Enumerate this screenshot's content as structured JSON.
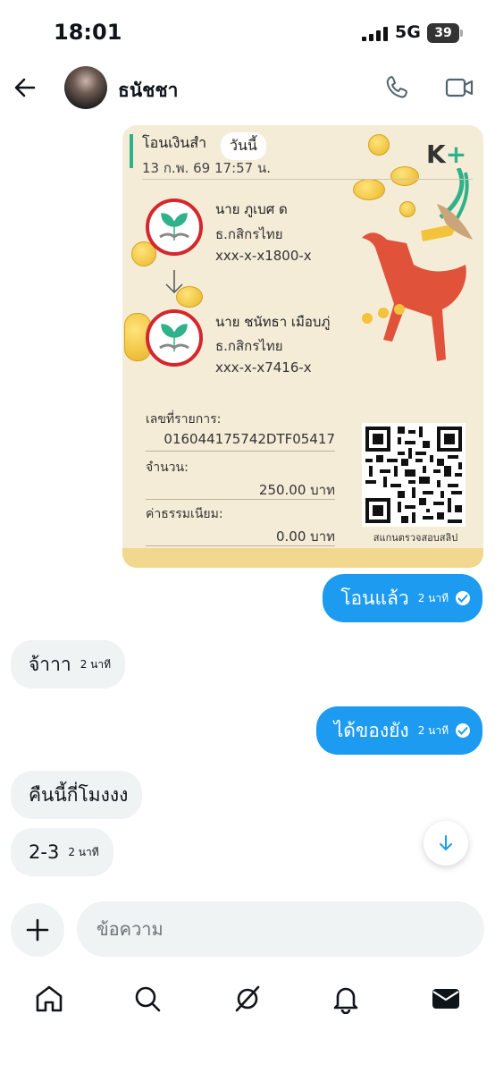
{
  "status_bar": {
    "time": "18:01",
    "network": "5G",
    "battery": "39"
  },
  "header": {
    "contact_name": "ธนัชชา"
  },
  "slip": {
    "title": "โอนเงินสำ",
    "today_label": "วันนี้",
    "date": "13 ก.พ. 69  17:57 น.",
    "brand": "K",
    "brand_plus": "+",
    "sender": {
      "name": "นาย ภูเบศ ด",
      "bank": "ธ.กสิกรไทย",
      "account": "xxx-x-x1800-x"
    },
    "receiver": {
      "name": "นาย ชนัทธา เมือบภู่",
      "bank": "ธ.กสิกรไทย",
      "account": "xxx-x-x7416-x"
    },
    "ref_label": "เลขที่รายการ:",
    "ref_value": "016044175742DTF05417",
    "amount_label": "จำนวน:",
    "amount_value": "250.00 บาท",
    "fee_label": "ค่าธรรมเนียม:",
    "fee_value": "0.00 บาท",
    "qr_caption": "สแกนตรวจสอบสลิป"
  },
  "messages": [
    {
      "direction": "out",
      "text": "โอนแล้ว",
      "time": "2 นาที",
      "read": true
    },
    {
      "direction": "in",
      "text": "จ้าาา",
      "time": "2 นาที"
    },
    {
      "direction": "out",
      "text": "ได้ของยัง",
      "time": "2 นาที",
      "read": true
    },
    {
      "direction": "in",
      "text": "คืนนี้กี่โมงงง",
      "time": ""
    },
    {
      "direction": "in",
      "text": "2-3",
      "time": "2 นาที"
    }
  ],
  "composer": {
    "placeholder": "ข้อความ"
  },
  "nav": {
    "items": [
      "home-icon",
      "search-icon",
      "grok-icon",
      "bell-icon",
      "mail-icon"
    ]
  },
  "colors": {
    "accent": "#1d9bf0",
    "incoming_bubble": "#eff3f4",
    "kbank_green": "#2fb18a",
    "kbank_red": "#d3282d"
  }
}
